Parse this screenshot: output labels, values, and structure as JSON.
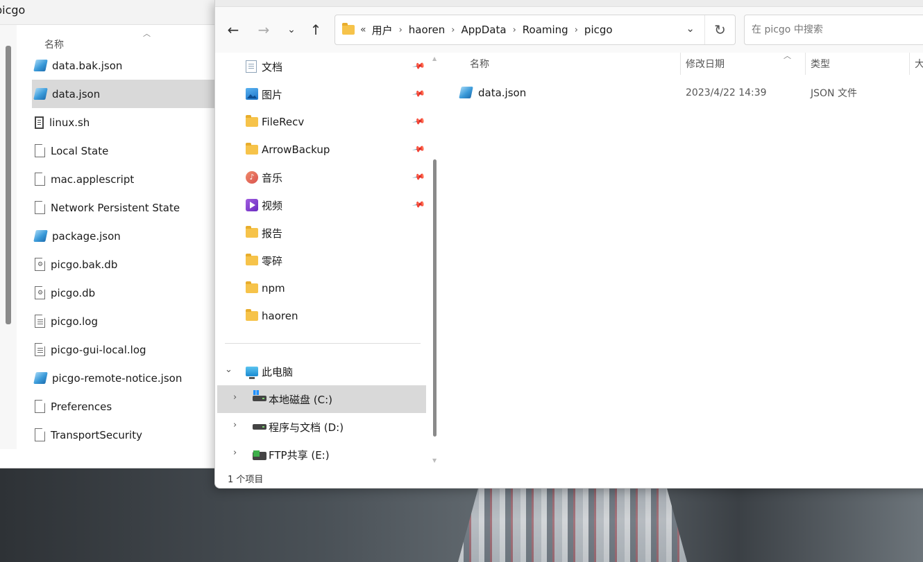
{
  "background_window": {
    "title": "picgo",
    "column_name": "名称",
    "files": [
      {
        "name": "data.bak.json",
        "icon": "json-file-icon",
        "selected": false
      },
      {
        "name": "data.json",
        "icon": "json-file-icon",
        "selected": true
      },
      {
        "name": "linux.sh",
        "icon": "shell-script-icon",
        "selected": false
      },
      {
        "name": "Local State",
        "icon": "file-icon",
        "selected": false
      },
      {
        "name": "mac.applescript",
        "icon": "file-icon",
        "selected": false
      },
      {
        "name": "Network Persistent State",
        "icon": "file-icon",
        "selected": false
      },
      {
        "name": "package.json",
        "icon": "json-file-icon",
        "selected": false
      },
      {
        "name": "picgo.bak.db",
        "icon": "database-file-icon",
        "selected": false
      },
      {
        "name": "picgo.db",
        "icon": "database-file-icon",
        "selected": false
      },
      {
        "name": "picgo.log",
        "icon": "text-file-icon",
        "selected": false
      },
      {
        "name": "picgo-gui-local.log",
        "icon": "text-file-icon",
        "selected": false
      },
      {
        "name": "picgo-remote-notice.json",
        "icon": "json-file-icon",
        "selected": false
      },
      {
        "name": "Preferences",
        "icon": "file-icon",
        "selected": false
      },
      {
        "name": "TransportSecurity",
        "icon": "file-icon",
        "selected": false
      }
    ]
  },
  "toolbar": {
    "back_icon": "back-arrow-icon",
    "forward_icon": "forward-arrow-icon",
    "history_icon": "chevron-down-icon",
    "up_icon": "up-arrow-icon"
  },
  "address": {
    "overflow": "«",
    "crumbs": [
      "用户",
      "haoren",
      "AppData",
      "Roaming",
      "picgo"
    ],
    "separator": "›",
    "dropdown": "⌄",
    "refresh": "↻"
  },
  "search": {
    "placeholder": "在 picgo 中搜索"
  },
  "nav": {
    "quick_access": [
      {
        "label": "文档",
        "icon": "documents-icon",
        "pinned": true
      },
      {
        "label": "图片",
        "icon": "pictures-icon",
        "pinned": true
      },
      {
        "label": "FileRecv",
        "icon": "folder-icon",
        "pinned": true
      },
      {
        "label": "ArrowBackup",
        "icon": "folder-icon",
        "pinned": true
      },
      {
        "label": "音乐",
        "icon": "music-icon",
        "pinned": true
      },
      {
        "label": "视频",
        "icon": "videos-icon",
        "pinned": true
      },
      {
        "label": "报告",
        "icon": "folder-icon",
        "pinned": false
      },
      {
        "label": "零碎",
        "icon": "folder-icon",
        "pinned": false
      },
      {
        "label": "npm",
        "icon": "folder-icon",
        "pinned": false
      },
      {
        "label": "haoren",
        "icon": "folder-icon",
        "pinned": false
      }
    ],
    "this_pc": {
      "label": "此电脑",
      "expanded": true
    },
    "drives": [
      {
        "label": "本地磁盘 (C:)",
        "icon": "windows-drive-icon",
        "selected": true
      },
      {
        "label": "程序与文档 (D:)",
        "icon": "drive-icon",
        "selected": false
      },
      {
        "label": "FTP共享 (E:)",
        "icon": "network-drive-icon",
        "selected": false
      }
    ]
  },
  "content": {
    "columns": {
      "name": "名称",
      "modified": "修改日期",
      "type": "类型",
      "size": "大"
    },
    "files": [
      {
        "name": "data.json",
        "modified": "2023/4/22 14:39",
        "type": "JSON 文件",
        "icon": "json-file-icon"
      }
    ]
  },
  "status": {
    "item_count": "1 个项目"
  },
  "colors": {
    "selection": "#d9d9d9",
    "folder": "#f6c34a",
    "window_bg": "#ffffff",
    "toolbar_bg": "#f9f9f9"
  }
}
